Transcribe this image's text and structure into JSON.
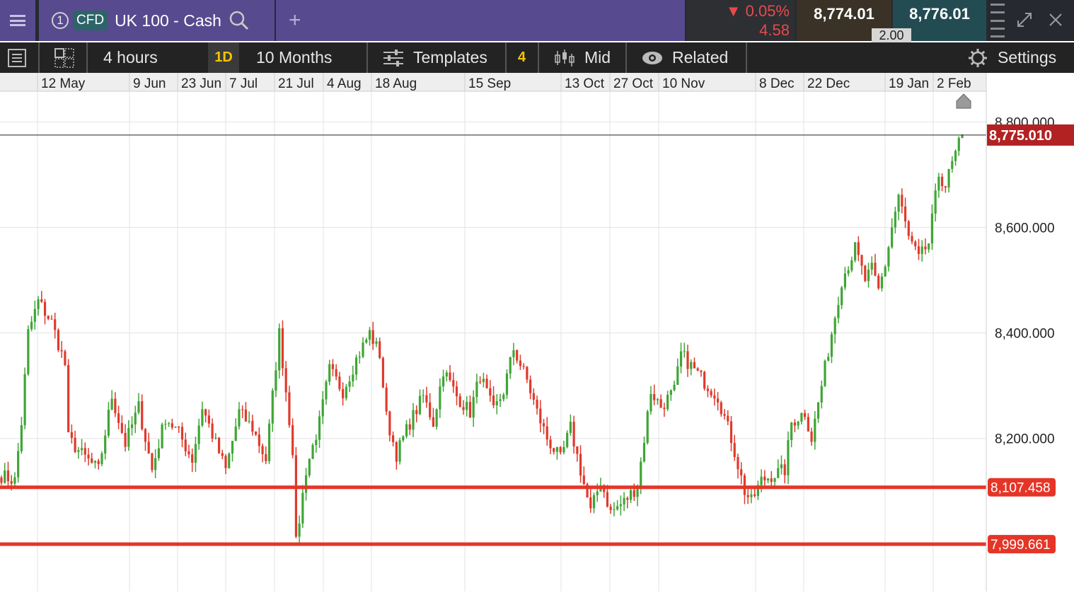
{
  "header": {
    "instrument_number": "1",
    "instrument_badge": "CFD",
    "instrument_name": "UK 100 - Cash",
    "change_pct": "0.05%",
    "change_abs": "4.58",
    "change_direction": "down",
    "sell_price": "8,774.01",
    "buy_price": "8,776.01",
    "spread": "2.00"
  },
  "toolbar": {
    "interval": "4 hours",
    "period_badge": "1D",
    "range": "10 Months",
    "templates_label": "Templates",
    "templates_count": "4",
    "price_type": "Mid",
    "related_label": "Related",
    "settings_label": "Settings"
  },
  "colors": {
    "purple": "#584a8e",
    "up": "#3fa535",
    "down": "#e03a2c",
    "level_line": "#e53527",
    "price_tag": "#b22222"
  },
  "chart_data": {
    "type": "candlestick",
    "x_tick_labels": [
      "12 May",
      "9 Jun",
      "23 Jun",
      "7 Jul",
      "21 Jul",
      "4 Aug",
      "18 Aug",
      "15 Sep",
      "13 Oct",
      "27 Oct",
      "10 Nov",
      "8 Dec",
      "22 Dec",
      "19 Jan",
      "2 Feb"
    ],
    "y_tick_labels": [
      "8,800.000",
      "8,600.000",
      "8,400.000",
      "8,200.000"
    ],
    "y_ticks": [
      8800,
      8600,
      8400,
      8200
    ],
    "ylim": [
      7910,
      8858
    ],
    "current_price": 8775.01,
    "current_price_label": "8,775.010",
    "horizontal_levels": [
      {
        "value": 8107.458,
        "label": "8,107.458"
      },
      {
        "value": 7999.661,
        "label": "7,999.661"
      }
    ],
    "path_anchors": [
      [
        0,
        8130
      ],
      [
        4,
        8120
      ],
      [
        6,
        8230
      ],
      [
        8,
        8400
      ],
      [
        11,
        8460
      ],
      [
        15,
        8420
      ],
      [
        19,
        8340
      ],
      [
        20,
        8200
      ],
      [
        24,
        8170
      ],
      [
        29,
        8140
      ],
      [
        33,
        8280
      ],
      [
        37,
        8190
      ],
      [
        41,
        8260
      ],
      [
        45,
        8140
      ],
      [
        49,
        8240
      ],
      [
        53,
        8210
      ],
      [
        57,
        8160
      ],
      [
        60,
        8260
      ],
      [
        64,
        8190
      ],
      [
        67,
        8140
      ],
      [
        71,
        8250
      ],
      [
        75,
        8220
      ],
      [
        79,
        8160
      ],
      [
        83,
        8400
      ],
      [
        87,
        8180
      ],
      [
        88,
        8000
      ],
      [
        91,
        8140
      ],
      [
        95,
        8230
      ],
      [
        98,
        8330
      ],
      [
        102,
        8290
      ],
      [
        106,
        8350
      ],
      [
        110,
        8400
      ],
      [
        113,
        8360
      ],
      [
        115,
        8240
      ],
      [
        118,
        8170
      ],
      [
        122,
        8230
      ],
      [
        126,
        8280
      ],
      [
        129,
        8230
      ],
      [
        132,
        8330
      ],
      [
        136,
        8280
      ],
      [
        140,
        8250
      ],
      [
        143,
        8320
      ],
      [
        147,
        8250
      ],
      [
        150,
        8290
      ],
      [
        153,
        8370
      ],
      [
        157,
        8310
      ],
      [
        160,
        8250
      ],
      [
        163,
        8200
      ],
      [
        167,
        8160
      ],
      [
        170,
        8220
      ],
      [
        173,
        8140
      ],
      [
        176,
        8060
      ],
      [
        179,
        8120
      ],
      [
        182,
        8060
      ],
      [
        186,
        8080
      ],
      [
        190,
        8110
      ],
      [
        194,
        8290
      ],
      [
        197,
        8260
      ],
      [
        201,
        8290
      ],
      [
        203,
        8360
      ],
      [
        207,
        8330
      ],
      [
        211,
        8300
      ],
      [
        214,
        8280
      ],
      [
        218,
        8200
      ],
      [
        222,
        8100
      ],
      [
        224,
        8080
      ],
      [
        227,
        8120
      ],
      [
        230,
        8130
      ],
      [
        234,
        8140
      ],
      [
        236,
        8230
      ],
      [
        240,
        8250
      ],
      [
        242,
        8200
      ],
      [
        245,
        8300
      ],
      [
        248,
        8400
      ],
      [
        251,
        8500
      ],
      [
        253,
        8530
      ],
      [
        255,
        8560
      ],
      [
        258,
        8500
      ],
      [
        260,
        8520
      ],
      [
        262,
        8480
      ],
      [
        264,
        8530
      ],
      [
        266,
        8600
      ],
      [
        268,
        8660
      ],
      [
        271,
        8580
      ],
      [
        274,
        8540
      ],
      [
        277,
        8570
      ],
      [
        280,
        8700
      ],
      [
        282,
        8680
      ],
      [
        284,
        8720
      ],
      [
        287,
        8775
      ]
    ]
  }
}
